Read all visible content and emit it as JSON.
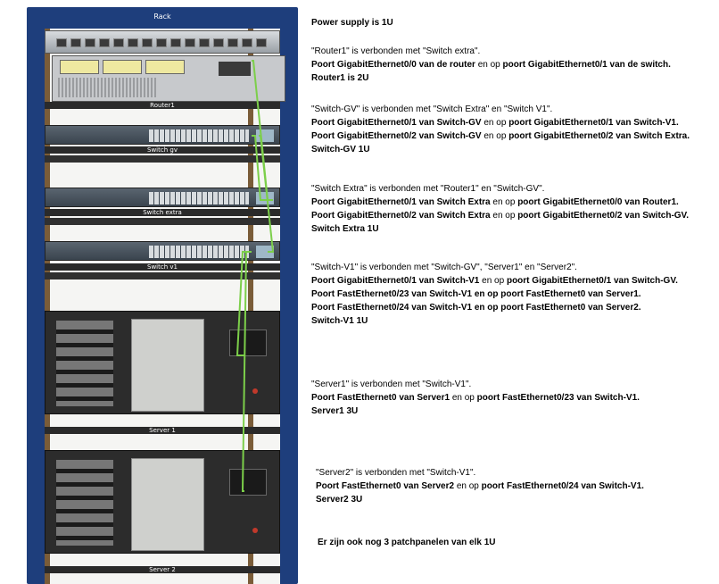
{
  "rack": {
    "title": "Rack",
    "units": {
      "router": "Router1",
      "switch_gv": "Switch gv",
      "switch_extra": "Switch extra",
      "switch_v1": "Switch v1",
      "server1": "Server 1",
      "server2": "Server 2"
    }
  },
  "notes": {
    "psu": "Power supply is 1U",
    "router": {
      "intro": "\"Router1\" is verbonden met \"Switch extra\".",
      "line1_a": "Poort GigabitEthernet0/0 van de router",
      "line1_b": " en op ",
      "line1_c": "poort GigabitEthernet0/1 van de switch.",
      "size": "Router1 is 2U"
    },
    "switch_gv": {
      "intro": "\"Switch-GV\" is verbonden met \"Switch Extra\" en \"Switch V1\".",
      "l1a": "Poort GigabitEthernet0/1 van Switch-GV",
      "l1b": " en op ",
      "l1c": "poort GigabitEthernet0/1 van Switch-V1.",
      "l2a": "Poort GigabitEthernet0/2 van Switch-GV",
      "l2b": " en op ",
      "l2c": "poort GigabitEthernet0/2 van Switch Extra.",
      "size": "Switch-GV 1U"
    },
    "switch_extra": {
      "intro": "\"Switch Extra\" is verbonden met \"Router1\" en \"Switch-GV\".",
      "l1a": "Poort GigabitEthernet0/1 van Switch Extra",
      "l1b": " en op ",
      "l1c": "poort GigabitEthernet0/0 van Router1.",
      "l2a": "Poort GigabitEthernet0/2 van Switch Extra",
      "l2b": " en op ",
      "l2c": "poort GigabitEthernet0/2 van Switch-GV.",
      "size": "Switch Extra 1U"
    },
    "switch_v1": {
      "intro": "\"Switch-V1\" is verbonden met \"Switch-GV\", \"Server1\" en \"Server2\".",
      "l1a": "Poort GigabitEthernet0/1 van Switch-V1",
      "l1b": " en op ",
      "l1c": "poort GigabitEthernet0/1 van Switch-GV.",
      "l2": "Poort FastEthernet0/23 van Switch-V1 en op poort FastEthernet0 van Server1.",
      "l3": "Poort FastEthernet0/24 van Switch-V1 en op poort FastEthernet0 van Server2.",
      "size": "Switch-V1 1U"
    },
    "server1": {
      "intro": "\"Server1\" is verbonden met \"Switch-V1\".",
      "l1a": "Poort FastEthernet0 van Server1",
      "l1b": " en op ",
      "l1c": "poort FastEthernet0/23 van Switch-V1.",
      "size": "Server1 3U"
    },
    "server2": {
      "intro": "\"Server2\" is verbonden met \"Switch-V1\".",
      "l1a": "Poort FastEthernet0 van Server2",
      "l1b": " en op ",
      "l1c": "poort FastEthernet0/24 van Switch-V1.",
      "size": "Server2 3U"
    },
    "patch": "Er zijn ook nog 3 patchpanelen van elk 1U"
  },
  "colors": {
    "rack_frame": "#1e3e7c",
    "cable": "#7ccf4a"
  }
}
